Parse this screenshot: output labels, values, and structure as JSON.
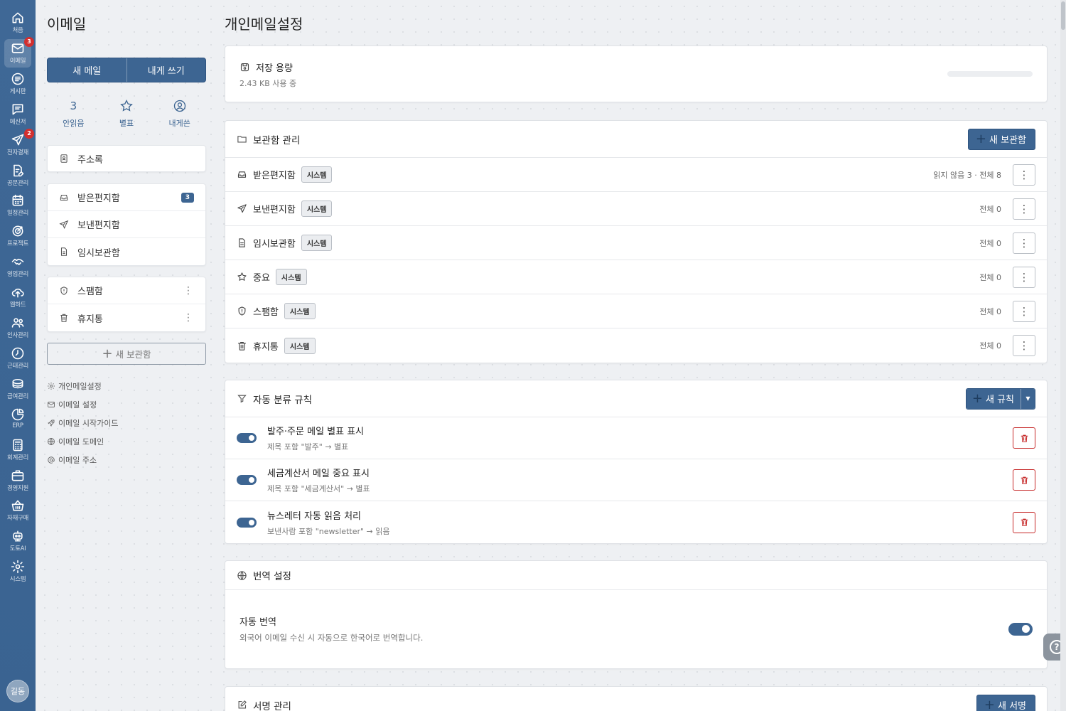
{
  "rail": {
    "items": [
      {
        "label": "처음",
        "icon": "home-icon"
      },
      {
        "label": "이메일",
        "icon": "mail-icon",
        "badge": "3"
      },
      {
        "label": "게시판",
        "icon": "board-icon"
      },
      {
        "label": "메신저",
        "icon": "messenger-icon"
      },
      {
        "label": "전자결재",
        "icon": "approval-icon",
        "badge": "2"
      },
      {
        "label": "공문관리",
        "icon": "document-edit-icon"
      },
      {
        "label": "일정관리",
        "icon": "calendar-icon"
      },
      {
        "label": "프로젝트",
        "icon": "target-icon"
      },
      {
        "label": "영업관리",
        "icon": "handshake-icon"
      },
      {
        "label": "웹하드",
        "icon": "cloud-upload-icon"
      },
      {
        "label": "인사관리",
        "icon": "people-icon"
      },
      {
        "label": "근태관리",
        "icon": "clock-icon"
      },
      {
        "label": "급여관리",
        "icon": "coins-icon"
      },
      {
        "label": "ERP",
        "icon": "pie-chart-icon"
      },
      {
        "label": "회계관리",
        "icon": "calculator-icon"
      },
      {
        "label": "경영지원",
        "icon": "briefcase-icon"
      },
      {
        "label": "자재구매",
        "icon": "basket-icon"
      },
      {
        "label": "도토AI",
        "icon": "robot-icon"
      },
      {
        "label": "시스템",
        "icon": "gear-icon"
      }
    ],
    "avatar": "길동"
  },
  "sidebar": {
    "title": "이메일",
    "new_mail": "새 메일",
    "write_to_me": "내게 쓰기",
    "quick": [
      {
        "value": "3",
        "label": "안읽음"
      },
      {
        "icon": "star-icon",
        "label": "별표"
      },
      {
        "icon": "user-circle-icon",
        "label": "내게쓴"
      }
    ],
    "address_book": "주소록",
    "folders": [
      {
        "label": "받은편지함",
        "badge": "3",
        "icon": "inbox-icon"
      },
      {
        "label": "보낸편지함",
        "icon": "send-icon"
      },
      {
        "label": "임시보관함",
        "icon": "draft-icon"
      }
    ],
    "custom_folders": [
      {
        "label": "스팸함",
        "icon": "shield-icon"
      },
      {
        "label": "휴지통",
        "icon": "trash-icon"
      }
    ],
    "new_folder": "새 보관함",
    "links": [
      {
        "label": "개인메일설정",
        "icon": "gear-icon"
      },
      {
        "label": "이메일 설정",
        "icon": "mail-icon"
      },
      {
        "label": "이메일 시작가이드",
        "icon": "rocket-icon"
      },
      {
        "label": "이메일 도메인",
        "icon": "globe-icon"
      },
      {
        "label": "이메일 주소",
        "icon": "at-icon"
      }
    ]
  },
  "main": {
    "title": "개인메일설정",
    "storage": {
      "title": "저장 용량",
      "usage": "2.43 KB 사용 중",
      "used_fraction": 0.0
    },
    "folders_panel": {
      "title": "보관함 관리",
      "new_button": "새 보관함",
      "rows": [
        {
          "name": "받은편지함",
          "tag": "시스템",
          "stat": "읽지 않음 3 · 전체 8",
          "icon": "inbox-icon"
        },
        {
          "name": "보낸편지함",
          "tag": "시스템",
          "stat": "전체 0",
          "icon": "send-icon"
        },
        {
          "name": "임시보관함",
          "tag": "시스템",
          "stat": "전체 0",
          "icon": "draft-icon"
        },
        {
          "name": "중요",
          "tag": "시스템",
          "stat": "전체 0",
          "icon": "star-icon"
        },
        {
          "name": "스팸함",
          "tag": "시스템",
          "stat": "전체 0",
          "icon": "shield-icon"
        },
        {
          "name": "휴지통",
          "tag": "시스템",
          "stat": "전체 0",
          "icon": "trash-icon"
        }
      ]
    },
    "rules_panel": {
      "title": "자동 분류 규칙",
      "new_button": "새 규칙",
      "rules": [
        {
          "name": "발주·주문 메일 별표 표시",
          "desc": "제목 포함 \"발주\" → 별표",
          "enabled": true
        },
        {
          "name": "세금계산서 메일 중요 표시",
          "desc": "제목 포함 \"세금계산서\" → 별표",
          "enabled": true
        },
        {
          "name": "뉴스레터 자동 읽음 처리",
          "desc": "보낸사람 포함 \"newsletter\" → 읽음",
          "enabled": true
        }
      ]
    },
    "translation_panel": {
      "title": "번역 설정",
      "option_title": "자동 번역",
      "option_desc": "외국어 이메일 수신 시 자동으로 한국어로 번역합니다.",
      "enabled": true
    },
    "signature_panel": {
      "title": "서명 관리",
      "new_button": "새 서명"
    }
  },
  "help": "?",
  "colors": {
    "accent": "#3d6592",
    "rail": "#3f6896",
    "danger": "#c62828",
    "badge": "#d32f2f"
  }
}
